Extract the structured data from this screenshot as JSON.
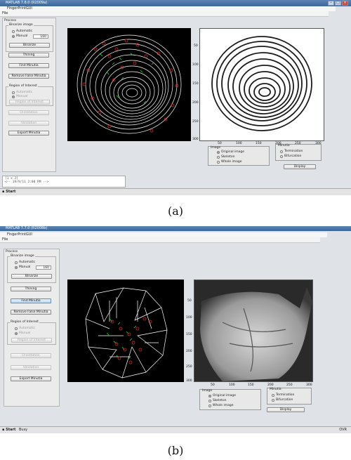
{
  "panel_a": {
    "window_title": "MATLAB 7.8.0 (R2009a)",
    "figure_title": "FingerPrintGUI",
    "menu_file": "File",
    "process_label": "Process",
    "binarize_group_label": "Binarize image",
    "radio_automatic": "Automatic",
    "radio_manual": "Manual",
    "threshold_value": "160",
    "btn_binarize": "Binarize",
    "btn_thinning": "Thining",
    "btn_find_minutia": "Find Minutia",
    "btn_remove_false": "Remove False Minutia",
    "roi_group_label": "Region of Interest",
    "roi_automatic": "Automatic",
    "roi_manual": "Manual",
    "btn_region_of_interest": "Region of Interest",
    "btn_orientation": "Orientation",
    "btn_validation": "Validation",
    "btn_export": "Export Minutia",
    "image_group_label": "Image",
    "opt_original": "Original image",
    "opt_skeleton": "Skeleton",
    "opt_whole": "Whole image",
    "minutia_group_label": "Minutia",
    "opt_termination": "Termination",
    "opt_bifurcation": "Bifurcation",
    "btn_display": "Display",
    "x_ticks": [
      "50",
      "100",
      "150",
      "200",
      "250",
      "300"
    ],
    "y_ticks": [
      "50",
      "100",
      "150",
      "200",
      "250",
      "300"
    ],
    "cmd_line1": "[1 x 2]",
    "cmd_line2": "<-- 19/9/11  2:08 PM -->",
    "start_label": "Start",
    "caption": "(a)"
  },
  "panel_b": {
    "window_title": "MATLAB 7.7.0 (R2008b)",
    "figure_title": "FingerPrintGUI",
    "menu_file": "File",
    "process_label": "Process",
    "binarize_group_label": "Binarize image",
    "radio_automatic": "Automatic",
    "radio_manual": "Manual",
    "threshold_value": "160",
    "btn_binarize": "Binarize",
    "btn_thinning": "Thining",
    "btn_find_minutia": "Find Minutia",
    "btn_remove_false": "Remove False Minutia",
    "roi_group_label": "Region of Interest",
    "roi_automatic": "Automatic",
    "roi_manual": "Manual",
    "btn_region_of_interest": "Region of Interest",
    "btn_orientation": "Orientation",
    "btn_validation": "Validation",
    "btn_export": "Export Minutia",
    "image_group_label": "Image",
    "opt_original": "Original image",
    "opt_skeleton": "Skeleton",
    "opt_whole": "Whole image",
    "minutia_group_label": "Minutia",
    "opt_termination": "Termination",
    "opt_bifurcation": "Bifurcation",
    "btn_display": "Display",
    "x_ticks": [
      "50",
      "100",
      "150",
      "200",
      "250",
      "300"
    ],
    "y_ticks": [
      "50",
      "100",
      "150",
      "200",
      "250",
      "300"
    ],
    "start_label": "Start",
    "status_text": "Busy",
    "status_right": "OVR",
    "caption": "(b)"
  },
  "colors": {
    "titlebar": "#3b679c",
    "termination_marker": "#d22a2a",
    "bifurcation_marker": "#2bd34a",
    "ridge_line": "#ffffff"
  }
}
